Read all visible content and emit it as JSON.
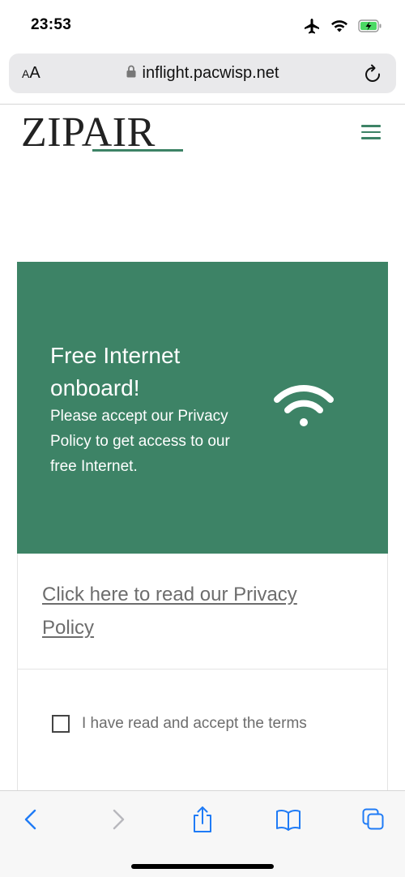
{
  "status_bar": {
    "time": "23:53",
    "icons": [
      "airplane-mode-icon",
      "wifi-icon",
      "battery-charging-icon"
    ],
    "battery_color": "#4cd964"
  },
  "browser": {
    "text_size_label_small": "A",
    "text_size_label_large": "A",
    "url": "inflight.pacwisp.net",
    "icons": [
      "lock-icon",
      "reload-icon"
    ]
  },
  "site": {
    "logo": "ZIPAIR",
    "brand_color": "#3d8366",
    "menu_icon": "hamburger-menu-icon"
  },
  "banner": {
    "title": "Free Internet onboard!",
    "text": "Please accept our Privacy Policy to get access to our free Internet.",
    "icon": "wifi-icon"
  },
  "card": {
    "privacy_link": "Click here to read our Privacy Policy",
    "terms_label": "I have read and accept the terms",
    "terms_checked": false
  },
  "toolbar": {
    "icons": [
      "back-icon",
      "forward-icon",
      "share-icon",
      "bookmarks-icon",
      "tabs-icon"
    ],
    "accent_color": "#1f7bf6"
  }
}
